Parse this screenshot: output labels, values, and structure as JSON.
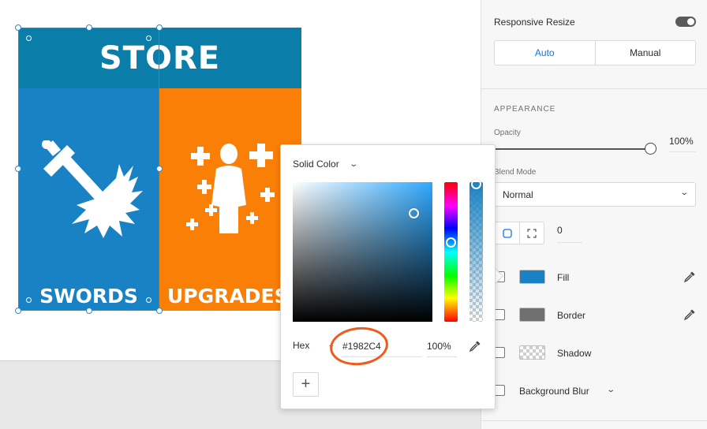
{
  "artboard": {
    "title": "STORE",
    "tiles": [
      {
        "label": "SWORDS",
        "color": "#1982C4",
        "icon": "sword-icon"
      },
      {
        "label": "UPGRADES",
        "color": "#FA7F07",
        "icon": "upgrade-figure-icon"
      }
    ],
    "header_color": "#0A7EA8"
  },
  "color_picker": {
    "fill_type": "Solid Color",
    "format_label": "Hex",
    "hex_value": "#1982C4",
    "alpha_value": "100%",
    "add_swatch_symbol": "+",
    "annotation_color": "#F05A1A"
  },
  "panel": {
    "responsive_resize": {
      "label": "Responsive Resize",
      "enabled": true,
      "options": [
        "Auto",
        "Manual"
      ],
      "selected": "Auto"
    },
    "appearance": {
      "title": "APPEARANCE",
      "opacity_label": "Opacity",
      "opacity_value": "100%",
      "blend_label": "Blend Mode",
      "blend_value": "Normal",
      "corner_radius": "0",
      "properties": [
        {
          "label": "Fill",
          "swatch": "#1982C4",
          "checked": true
        },
        {
          "label": "Border",
          "swatch": "#707070",
          "checked": false
        },
        {
          "label": "Shadow",
          "swatch": "checker",
          "checked": false
        },
        {
          "label": "Background Blur",
          "checked": false
        }
      ]
    }
  }
}
